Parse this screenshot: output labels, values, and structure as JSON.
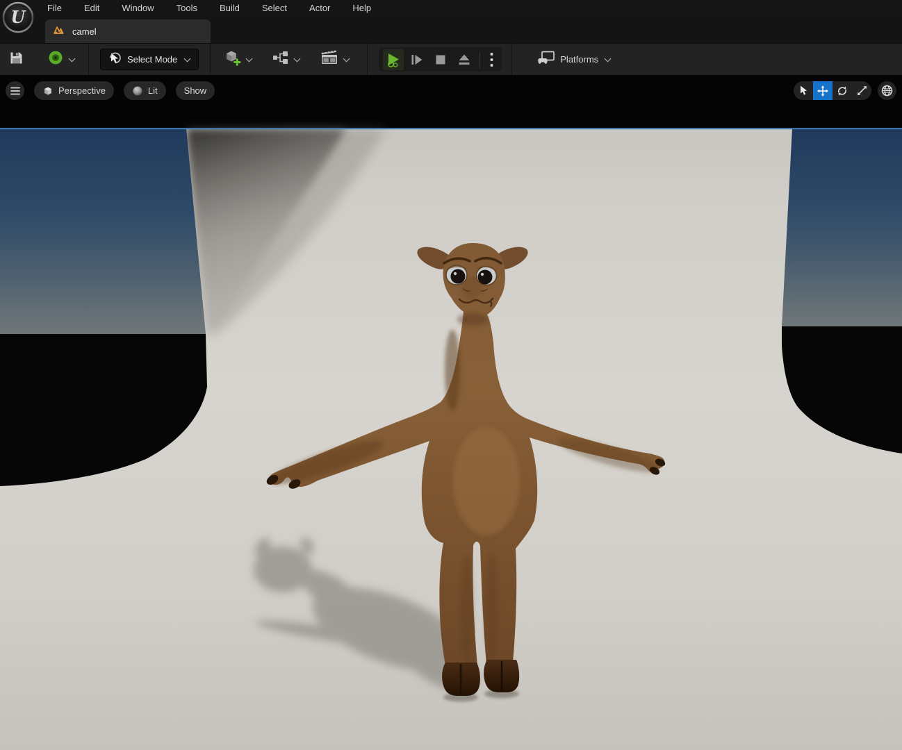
{
  "app": {
    "name": "Unreal Editor",
    "logo_icon": "unreal-engine-logo"
  },
  "menu_bar": {
    "items": [
      {
        "label": "File"
      },
      {
        "label": "Edit"
      },
      {
        "label": "Window"
      },
      {
        "label": "Tools"
      },
      {
        "label": "Build"
      },
      {
        "label": "Select"
      },
      {
        "label": "Actor"
      },
      {
        "label": "Help"
      }
    ]
  },
  "tab_bar": {
    "active_tab": {
      "label": "camel",
      "icon": "level-tab-icon",
      "active": true
    }
  },
  "toolbar": {
    "save_icon": "save-disk-icon",
    "source_control_icon": "revision-control-status-icon",
    "select_mode": {
      "label": "Select Mode",
      "icon": "cursor-icon"
    },
    "add_actor_icon": "add-actor-cube-icon",
    "blueprints_icon": "blueprints-node-icon",
    "cinematics_icon": "cinematics-clapperboard-icon",
    "play_controls": {
      "play": "play-icon",
      "frame_skip": "frame-skip-icon",
      "stop": "stop-icon",
      "eject": "eject-icon",
      "more": "kebab-menu-icon"
    },
    "platforms": {
      "label": "Platforms",
      "icon": "platforms-device-icon"
    }
  },
  "viewport": {
    "toolbar_left": {
      "menu_icon": "hamburger-menu-icon",
      "perspective_label": "Perspective",
      "lit_label": "Lit",
      "show_label": "Show"
    },
    "toolbar_right": {
      "tools": [
        "select",
        "move",
        "rotate",
        "scale"
      ],
      "active_tool": "move",
      "world_icon": "globe-icon"
    },
    "scene": {
      "model": "camel",
      "description": "brown cartoon camel in T-pose on a white studio cyclorama, blue sky visible at left and right edges, soft shadow cast on floor"
    }
  },
  "colors": {
    "accent_blue": "#1673c9",
    "play_green": "#6ab82d",
    "tab_icon_orange": "#e39b3b",
    "menu_bg": "#151515",
    "tab_bg": "#2b2b2b",
    "toolbar_bg": "#232323",
    "sky_top": "#20395c",
    "sky_horizon": "#6e7678",
    "backdrop_light": "#d6d3ce",
    "camel_brown": "#7f5835"
  }
}
